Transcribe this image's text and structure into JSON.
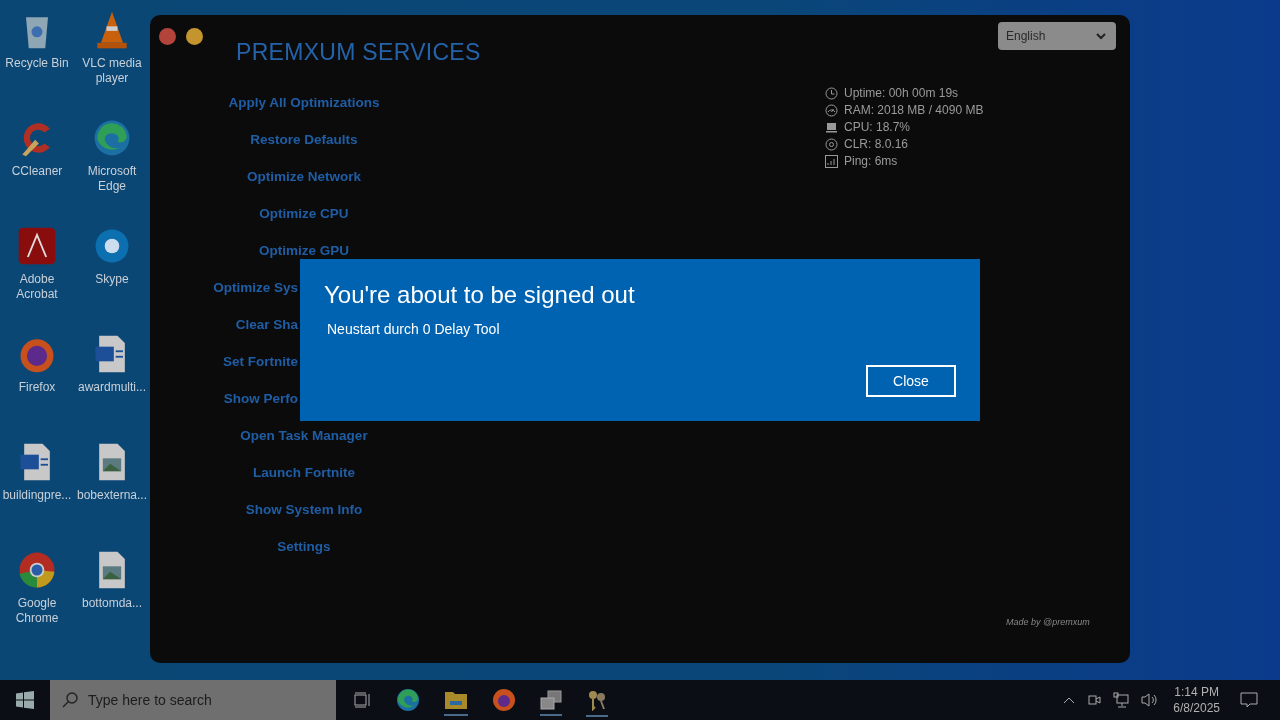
{
  "desktop_icons": [
    {
      "label": "Recycle Bin"
    },
    {
      "label": "VLC media player"
    },
    {
      "label": "CCleaner"
    },
    {
      "label": "Microsoft Edge"
    },
    {
      "label": "Adobe Acrobat"
    },
    {
      "label": "Skype"
    },
    {
      "label": "Firefox"
    },
    {
      "label": "awardmulti..."
    },
    {
      "label": "buildingpre..."
    },
    {
      "label": "bobexterna..."
    },
    {
      "label": "Google Chrome"
    },
    {
      "label": "bottomda..."
    }
  ],
  "app_window": {
    "title": "PREMXUM SERVICES",
    "language": "English",
    "menu": [
      {
        "label": "Apply All Optimizations",
        "kind": "full"
      },
      {
        "label": "Restore Defaults",
        "kind": "full"
      },
      {
        "label": "Optimize Network",
        "kind": "full"
      },
      {
        "label": "Optimize CPU",
        "kind": "full"
      },
      {
        "label": "Optimize GPU",
        "kind": "full"
      },
      {
        "label": "Optimize Sys",
        "kind": "cut"
      },
      {
        "label": "Clear Sha",
        "kind": "cut"
      },
      {
        "label": "Set Fortnite",
        "kind": "cut"
      },
      {
        "label": "Show Perfo",
        "kind": "cut"
      },
      {
        "label": "Open Task Manager",
        "kind": "full"
      },
      {
        "label": "Launch Fortnite",
        "kind": "full"
      },
      {
        "label": "Show System Info",
        "kind": "full"
      },
      {
        "label": "Settings",
        "kind": "full"
      }
    ],
    "system_info": [
      {
        "text": "Uptime: 00h 00m 19s"
      },
      {
        "text": "RAM: 2018 MB / 4090 MB"
      },
      {
        "text": "CPU: 18.7%"
      },
      {
        "text": "CLR: 8.0.16"
      },
      {
        "text": "Ping: 6ms"
      }
    ],
    "credit": "Made by @premxum"
  },
  "dialog": {
    "title": "You're about to be signed out",
    "message": "Neustart durch 0 Delay Tool",
    "button": "Close"
  },
  "taskbar": {
    "search_placeholder": "Type here to search",
    "time": "1:14 PM",
    "date": "6/8/2025"
  }
}
